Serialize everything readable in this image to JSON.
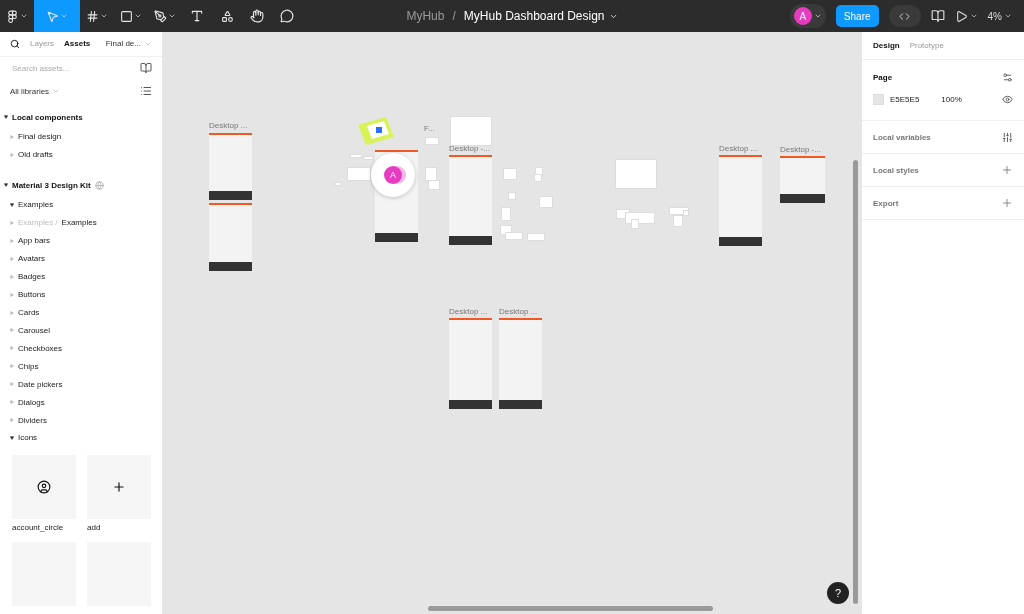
{
  "toolbar": {
    "tools": [
      {
        "kind": "main-menu",
        "selected": false
      },
      {
        "kind": "move",
        "selected": true
      },
      {
        "kind": "frame",
        "selected": false
      },
      {
        "kind": "shape",
        "selected": false
      },
      {
        "kind": "pen",
        "selected": false
      },
      {
        "kind": "text",
        "selected": false
      },
      {
        "kind": "resources",
        "selected": false
      },
      {
        "kind": "hand",
        "selected": false
      },
      {
        "kind": "comment",
        "selected": false
      }
    ],
    "project": "MyHub",
    "separator": "/",
    "file_name": "MyHub Dashboard Design",
    "user_avatar": "A",
    "share_label": "Share",
    "dev_mode": false,
    "zoom": "4%"
  },
  "left_panel": {
    "tabs": [
      {
        "label": "Layers",
        "selected": false
      },
      {
        "label": "Assets",
        "selected": true
      }
    ],
    "page_dropdown": "Final de...",
    "search": {
      "placeholder": "Search assets..."
    },
    "library_filter": "All libraries",
    "sections": [
      {
        "title": "Local components",
        "expanded": true,
        "library": false,
        "items": [
          {
            "name": "Final design",
            "expanded": false
          },
          {
            "name": "Old drafts",
            "expanded": false
          }
        ]
      },
      {
        "title": "Material 3 Design Kit",
        "expanded": true,
        "library": true,
        "items": [
          {
            "name": "Examples",
            "expanded": true
          },
          {
            "path": "Examples /",
            "name": "Examples",
            "expanded": false
          },
          {
            "name": "App bars",
            "expanded": false
          },
          {
            "name": "Avatars",
            "expanded": false
          },
          {
            "name": "Badges",
            "expanded": false
          },
          {
            "name": "Buttons",
            "expanded": false
          },
          {
            "name": "Cards",
            "expanded": false
          },
          {
            "name": "Carousel",
            "expanded": false
          },
          {
            "name": "Checkboxes",
            "expanded": false
          },
          {
            "name": "Chips",
            "expanded": false
          },
          {
            "name": "Date pickers",
            "expanded": false
          },
          {
            "name": "Dialogs",
            "expanded": false
          },
          {
            "name": "Dividers",
            "expanded": false
          },
          {
            "name": "Icons",
            "expanded": true
          }
        ]
      }
    ],
    "icon_tiles": [
      {
        "kind": "account",
        "label": "account_circle"
      },
      {
        "kind": "add",
        "label": "add"
      },
      {
        "kind": "blank"
      },
      {
        "kind": "blank"
      }
    ]
  },
  "canvas": {
    "frames": [
      {
        "label": "Desktop ..."
      },
      {
        "label": "F..."
      },
      {
        "label": "Desktop -..."
      },
      {
        "label": "Desktop ..."
      },
      {
        "label": "Desktop -..."
      },
      {
        "label": "Desktop ..."
      },
      {
        "label": "Desktop ..."
      }
    ],
    "cursor_avatar": "A",
    "help": "?"
  },
  "right_panel": {
    "tabs": [
      {
        "label": "Design",
        "selected": true
      },
      {
        "label": "Prototype",
        "selected": false
      }
    ],
    "page": {
      "title": "Page",
      "color": "#e5e5e5",
      "hex": "E5E5E5",
      "opacity": "100%"
    },
    "sections": [
      {
        "title": "Local variables",
        "kind": "variables"
      },
      {
        "title": "Local styles",
        "kind": "add"
      },
      {
        "title": "Export",
        "kind": "add"
      }
    ]
  }
}
